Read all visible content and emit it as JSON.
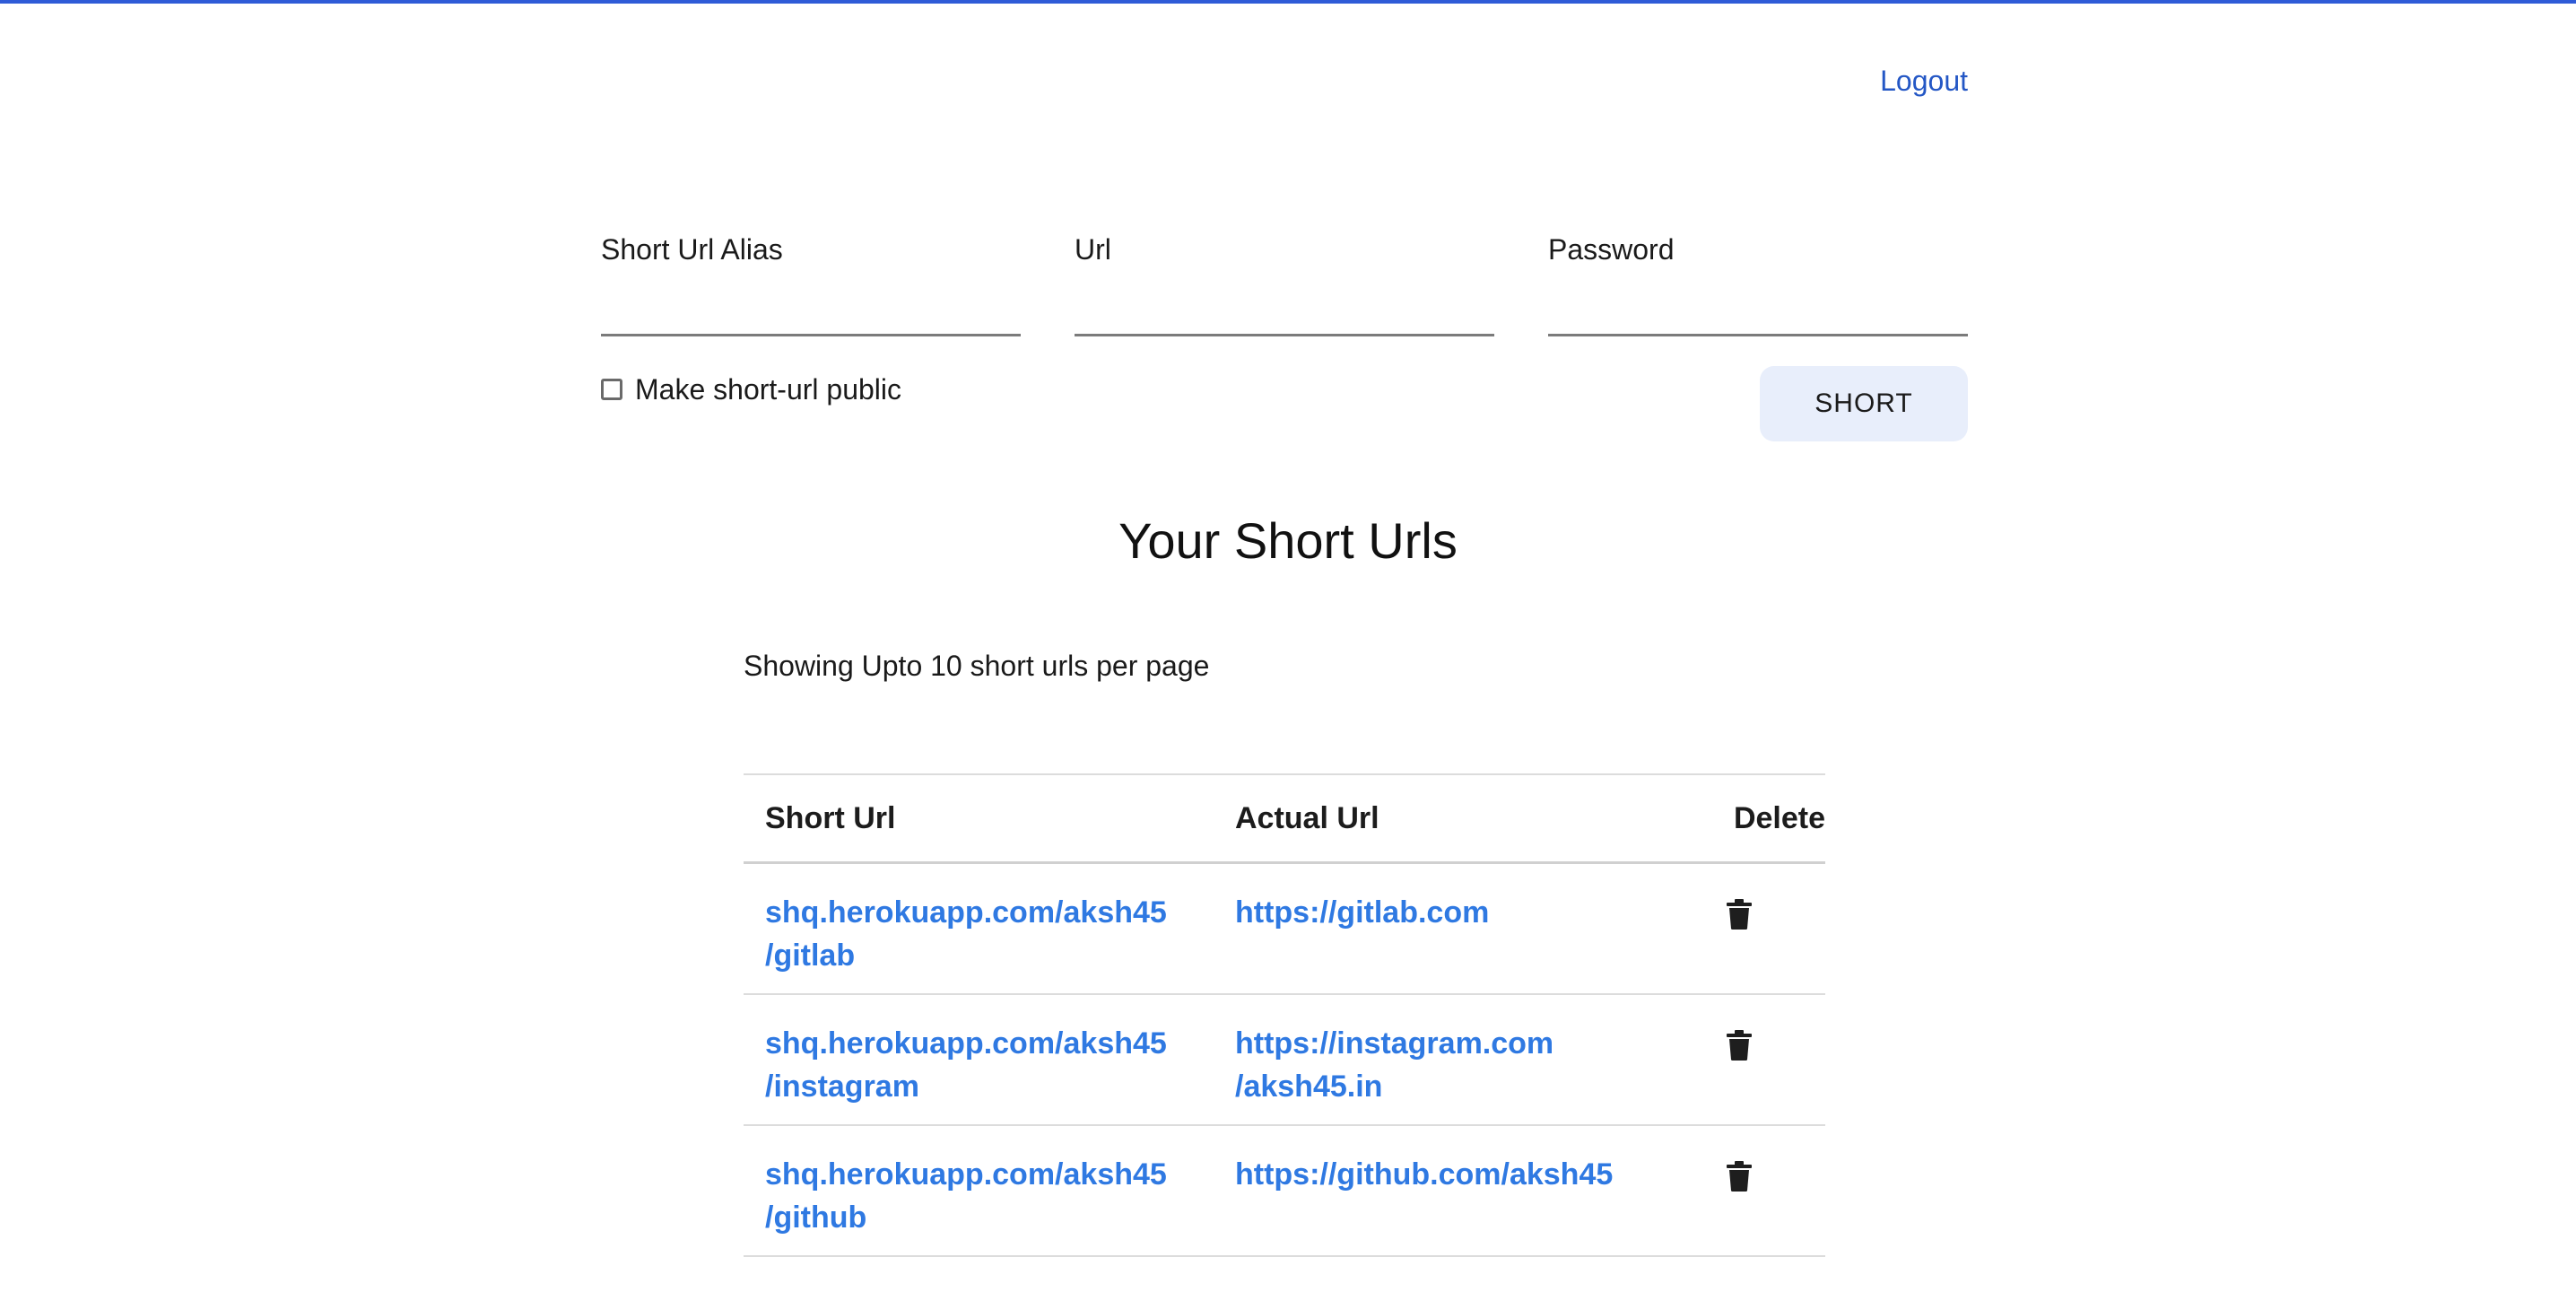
{
  "header": {
    "logout_label": "Logout"
  },
  "form": {
    "alias_label": "Short Url Alias",
    "url_label": "Url",
    "password_label": "Password",
    "alias_value": "",
    "url_value": "",
    "password_value": "",
    "public_label": "Make short-url public",
    "public_checked": false,
    "submit_label": "SHORT"
  },
  "main": {
    "title": "Your Short Urls",
    "showing_text": "Showing Upto 10 short urls per page"
  },
  "table": {
    "headers": {
      "short_url": "Short Url",
      "actual_url": "Actual Url",
      "delete": "Delete"
    },
    "rows": [
      {
        "short_url_line1": "shq.herokuapp.com/aksh45",
        "short_url_line2": "/gitlab",
        "actual_url_line1": "https://gitlab.com",
        "actual_url_line2": ""
      },
      {
        "short_url_line1": "shq.herokuapp.com/aksh45",
        "short_url_line2": "/instagram",
        "actual_url_line1": "https://instagram.com",
        "actual_url_line2": "/aksh45.in"
      },
      {
        "short_url_line1": "shq.herokuapp.com/aksh45",
        "short_url_line2": "/github",
        "actual_url_line1": "https://github.com/aksh45",
        "actual_url_line2": ""
      }
    ]
  },
  "colors": {
    "accent_line": "#2f5bd7",
    "link": "#2f79e2",
    "logout": "#2457c5",
    "button_bg": "#e8eefb"
  },
  "icons": {
    "delete": "trash-icon"
  }
}
